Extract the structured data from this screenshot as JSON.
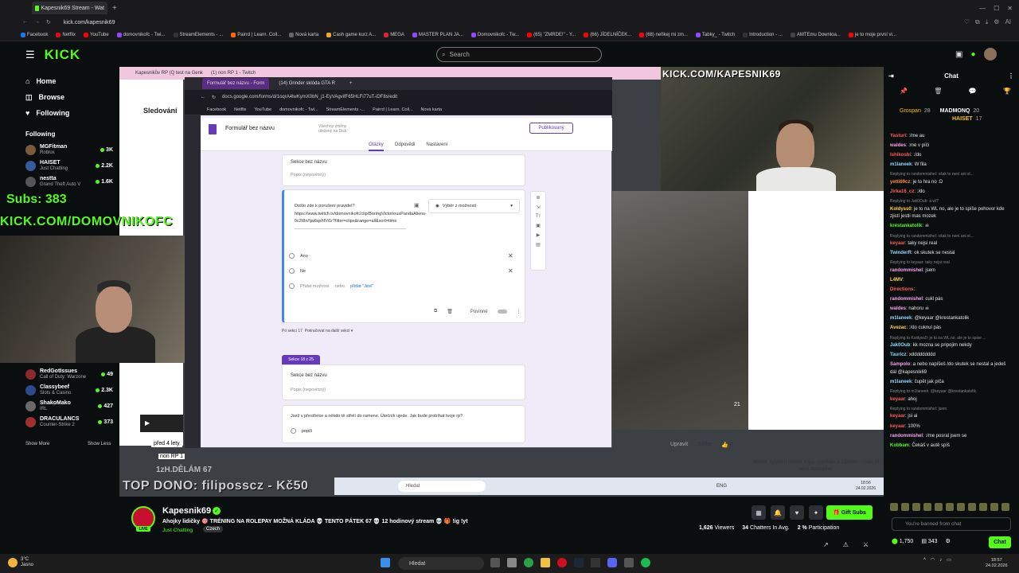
{
  "browser": {
    "tab_title": "Kapesnik69 Stream - Wat",
    "url": "kick.com/kapesnik69",
    "bookmarks": [
      "Facebook",
      "Netflix",
      "YouTube",
      "domovnikofc - Twi...",
      "StreamElements - ...",
      "Pairrd | Learn. Coll...",
      "Nová karta",
      "Cash game kurz A...",
      "MEGA",
      "MASTER PLAN JA...",
      "Domovnikofc - Tw...",
      "(65) \"ZMRDE!\" - Y...",
      "(66) JÍDELNÍČEK...",
      "(68) neřikej mi zm...",
      "Tabky_ - Twitch",
      "Introduction - ...",
      "AMTEmu Downloa...",
      "je to moje první vi..."
    ]
  },
  "kick": {
    "logo": "KICK",
    "search_placeholder": "Search"
  },
  "sidebar": {
    "nav": [
      {
        "label": "Home",
        "icon": "home-icon"
      },
      {
        "label": "Browse",
        "icon": "browse-icon"
      },
      {
        "label": "Following",
        "icon": "heart-icon"
      }
    ],
    "following_title": "Following",
    "following_top": [
      {
        "name": "MGFitman",
        "category": "Roblox",
        "viewers": "3K",
        "color": "#7a5a3c"
      },
      {
        "name": "HAISET",
        "category": "Just Chatting",
        "viewers": "2.2K",
        "color": "#3a5aa0"
      },
      {
        "name": "nestta",
        "category": "Grand Theft Auto V",
        "viewers": "1.6K",
        "color": "#555"
      }
    ],
    "following_bottom": [
      {
        "name": "RedGotIssues",
        "category": "Call of Duty: Warzone",
        "viewers": "49",
        "color": "#8b2a2a"
      },
      {
        "name": "Classybeef",
        "category": "Slots & Casino",
        "viewers": "2.3K",
        "color": "#2a4a8b"
      },
      {
        "name": "ShakoMako",
        "category": "IRL",
        "viewers": "427",
        "color": "#6a6a6a"
      },
      {
        "name": "DRACULANCS",
        "category": "Counter-Strike 2",
        "viewers": "373",
        "color": "#a03030"
      }
    ],
    "show_more": "Show More",
    "show_less": "Show Less"
  },
  "overlay": {
    "subs": "Subs: 383",
    "kick_url_left": "KICK.COM/DOMOVNIKOFC",
    "kick_url_top": "KICK.COM/KAPESNIK69",
    "top_dono": "TOP DONO: filiposscz - Kč50",
    "ago": "před 4 lety",
    "category_overlay": "non RP 1",
    "partial_text": "1zH.DĚLÁM 67"
  },
  "inner_browser": {
    "active_tab": "Formulář bez názvu - Form",
    "tab2": "(14) Grinder sklóda GTA R",
    "url": "docs.google.com/forms/d/1oqrA4lwKymX0bN_j1-EyVAgvifF65HLFi77uT-iDF8s/edit",
    "bg_tab1": "Kapesnikův RP (Q test na Genk",
    "bg_tab2": "(1) non RP 1 - Twitch",
    "twitch_heading": "Sledování",
    "bookmarks": [
      "Facebook",
      "Netflix",
      "YouTube",
      "domovnikofc - Twi...",
      "StreamElements -...",
      "Pairrd | Learn. Coll...",
      "Nová karta"
    ]
  },
  "form": {
    "title": "Formulář bez názvu",
    "saved_note": "Všechny změny uloženy na Disk",
    "publish": "Publikovaný",
    "tabs": [
      "Otázky",
      "Odpovědi",
      "Nastavení"
    ],
    "section1_title": "Sekce bez názvu",
    "section1_desc": "Popis (nepovinný)",
    "question_text": "Došlo zde k porušení pravidel? https://www.twitch.tv/domovnikofc/clip/BoringVictoriousPandaAliens-0c2t8n/\\jw6qshfVi1r?filter=clips&range=all&sort=time",
    "question_type": "Výběr z možností",
    "option1": "Ano",
    "option2": "Ne",
    "add_option": "Přidat možnost",
    "add_option_or": "nebo",
    "add_other": "přidat \"Jiné\"",
    "required": "Povinné",
    "after_section": "Po sekci 17",
    "continue": "Pokračovat na další sekci",
    "section_badge": "Sekce 18 z 25",
    "section2_title": "Sekce bez názvu",
    "section2_desc": "Popis (nepovinný)",
    "question2": "Jsež v přestřelce a někdo tě střelí do ramene. Útočník ujede. Jak bude probíhat tvoje rp?",
    "question2_option": "popiš"
  },
  "gta": {
    "timer": "21",
    "edit": "Upravit",
    "share": "Sdílet",
    "likes": "0",
    "unavailable": "Minulé vysílání tohoto klipu vypršelo a záznam chatu již není dostupný."
  },
  "inner_taskbar": {
    "search": "Hledat",
    "lang": "ENG",
    "time": "18:56",
    "date": "24.02.2026"
  },
  "chat": {
    "title": "Chat",
    "gifter1": "Grospan",
    "gifter1_count": "28",
    "gifter2": "MADMONQ",
    "gifter2_count": "20",
    "gifter3": "HAISET",
    "gifter3_count": "17",
    "messages": [
      {
        "user": "Yasturi",
        "text": ":/me au",
        "color": "#ff5b5b"
      },
      {
        "user": "waldes",
        "text": ":me v píči",
        "color": "#ff9ff3"
      },
      {
        "user": "Ishikoshi",
        "text": ":/do",
        "color": "#ff5b5b"
      },
      {
        "user": "m1laneek",
        "text": "W fila",
        "color": "#8fd4ff"
      },
      {
        "reply": "Replying to randommishel: však to není ani sl...",
        "user": "yetti69cz",
        "text": "je to hra no :D",
        "color": "#ff8c42"
      },
      {
        "user": "Jirka16_cz",
        "text": ":/do",
        "color": "#ff5b5b"
      },
      {
        "reply": "Replying to Jak0Oub: a wl?",
        "user": "Koldyss0",
        "text": "je to na WL no, ale je to spíše pohovor kde zjistí jestli mas mozek",
        "color": "#ffd54f"
      },
      {
        "user": "krestankatolik",
        "text": "☠",
        "color": "#53fc18"
      },
      {
        "reply": "Replying to randommishel: však to není ani sl...",
        "user": "keyaar",
        "text": "taky nejsi real",
        "color": "#ff5b5b"
      },
      {
        "user": "TwinderR",
        "text": "ok skutek se nestal",
        "color": "#8fd4ff"
      },
      {
        "reply": "Replying to keyaar: taky nejsi real",
        "user": "randommishel",
        "text": "jsem",
        "color": "#ff9ff3"
      },
      {
        "user": "L4MV",
        "text": "",
        "color": "#ffd54f"
      },
      {
        "user": "Directions",
        "text": "",
        "color": "#ff5b5b"
      },
      {
        "user": "randommishel",
        "text": "cukl pás",
        "color": "#ff9ff3"
      },
      {
        "user": "waldes",
        "text": "nahoru ☠",
        "color": "#ff9ff3"
      },
      {
        "user": "m1laneek",
        "text": "@keyaar @krestankatolik",
        "color": "#8fd4ff"
      },
      {
        "user": "Avezac",
        "text": ":/do cuknul pás",
        "color": "#ffd54f"
      },
      {
        "reply": "Replying to Koldyss0: je to na WL no, ale je to spise ...",
        "user": "Jak0Oub",
        "text": "kk mozna se pripojim nekdy",
        "color": "#8fd4ff"
      },
      {
        "user": "Tauricz",
        "text": "xddddddddd",
        "color": "#8fd4ff"
      },
      {
        "user": "Sampolo",
        "text": "a nebo napíšeš /do skutek se nestal a jedeš dál @kapesnik69",
        "color": "#ff9ff3"
      },
      {
        "user": "m1laneek",
        "text": "čupět jak píča",
        "color": "#8fd4ff"
      },
      {
        "reply": "Replying to m1laneek: @keyaar @krestankatolik",
        "user": "keyaar",
        "text": "ahoj",
        "color": "#ff5b5b"
      },
      {
        "reply": "Replying to randommishel: jsem",
        "user": "keyaar",
        "text": "jsi ai",
        "color": "#ff5b5b"
      },
      {
        "user": "keyaar",
        "text": "100%",
        "color": "#ff5b5b"
      },
      {
        "user": "randommishel",
        "text": ":/me posral jsem se",
        "color": "#ff9ff3"
      },
      {
        "user": "Kobbam",
        "text": "Čekáš v autě spíš",
        "color": "#53fc18"
      }
    ],
    "input_placeholder": "You're banned from chat",
    "points": "1,750",
    "emote_count": "343",
    "chat_button": "Chat"
  },
  "streamer": {
    "name": "Kapesnik69",
    "live": "LIVE",
    "title": "Ahojky lidičky 🎯 TRÉNING NA ROLEPAY MOŽNÁ KLÁDA 💀 TENTO PÁTEK 67 💀 12 hodinový stream 💀 🎁 !ig !yt",
    "category": "Just Chatting",
    "tag": "Czech",
    "gift_subs": "Gift Subs",
    "viewers": "1,626",
    "viewers_label": "Viewers",
    "chatters": "34",
    "chatters_label": "Chatters In Avg.",
    "participation": "2 %",
    "participation_label": "Participation"
  },
  "os": {
    "weather_temp": "3°C",
    "weather_desc": "Jasno",
    "search": "Hledat",
    "time": "18:57",
    "date": "24.02.2026"
  }
}
